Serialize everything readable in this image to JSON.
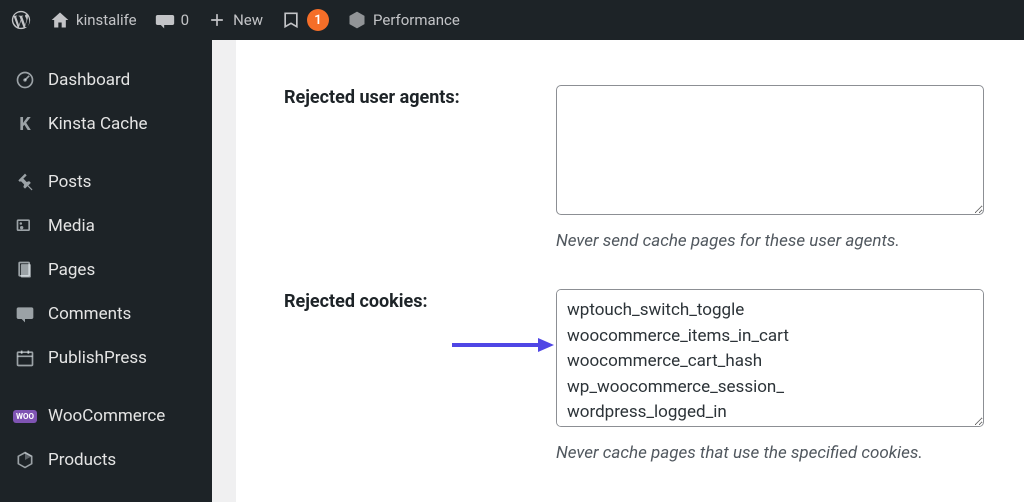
{
  "adminBar": {
    "siteTitle": "kinstalife",
    "commentsCount": "0",
    "newLabel": "New",
    "yoastBadge": "1",
    "performanceLabel": "Performance"
  },
  "sidebar": {
    "items": [
      {
        "label": "Dashboard"
      },
      {
        "label": "Kinsta Cache"
      },
      {
        "label": "Posts"
      },
      {
        "label": "Media"
      },
      {
        "label": "Pages"
      },
      {
        "label": "Comments"
      },
      {
        "label": "PublishPress"
      },
      {
        "label": "WooCommerce"
      },
      {
        "label": "Products"
      }
    ]
  },
  "form": {
    "rejectedUserAgents": {
      "label": "Rejected user agents:",
      "value": "",
      "help": "Never send cache pages for these user agents."
    },
    "rejectedCookies": {
      "label": "Rejected cookies:",
      "value": "wptouch_switch_toggle\nwoocommerce_items_in_cart\nwoocommerce_cart_hash\nwp_woocommerce_session_\nwordpress_logged_in",
      "help": "Never cache pages that use the specified cookies."
    }
  }
}
